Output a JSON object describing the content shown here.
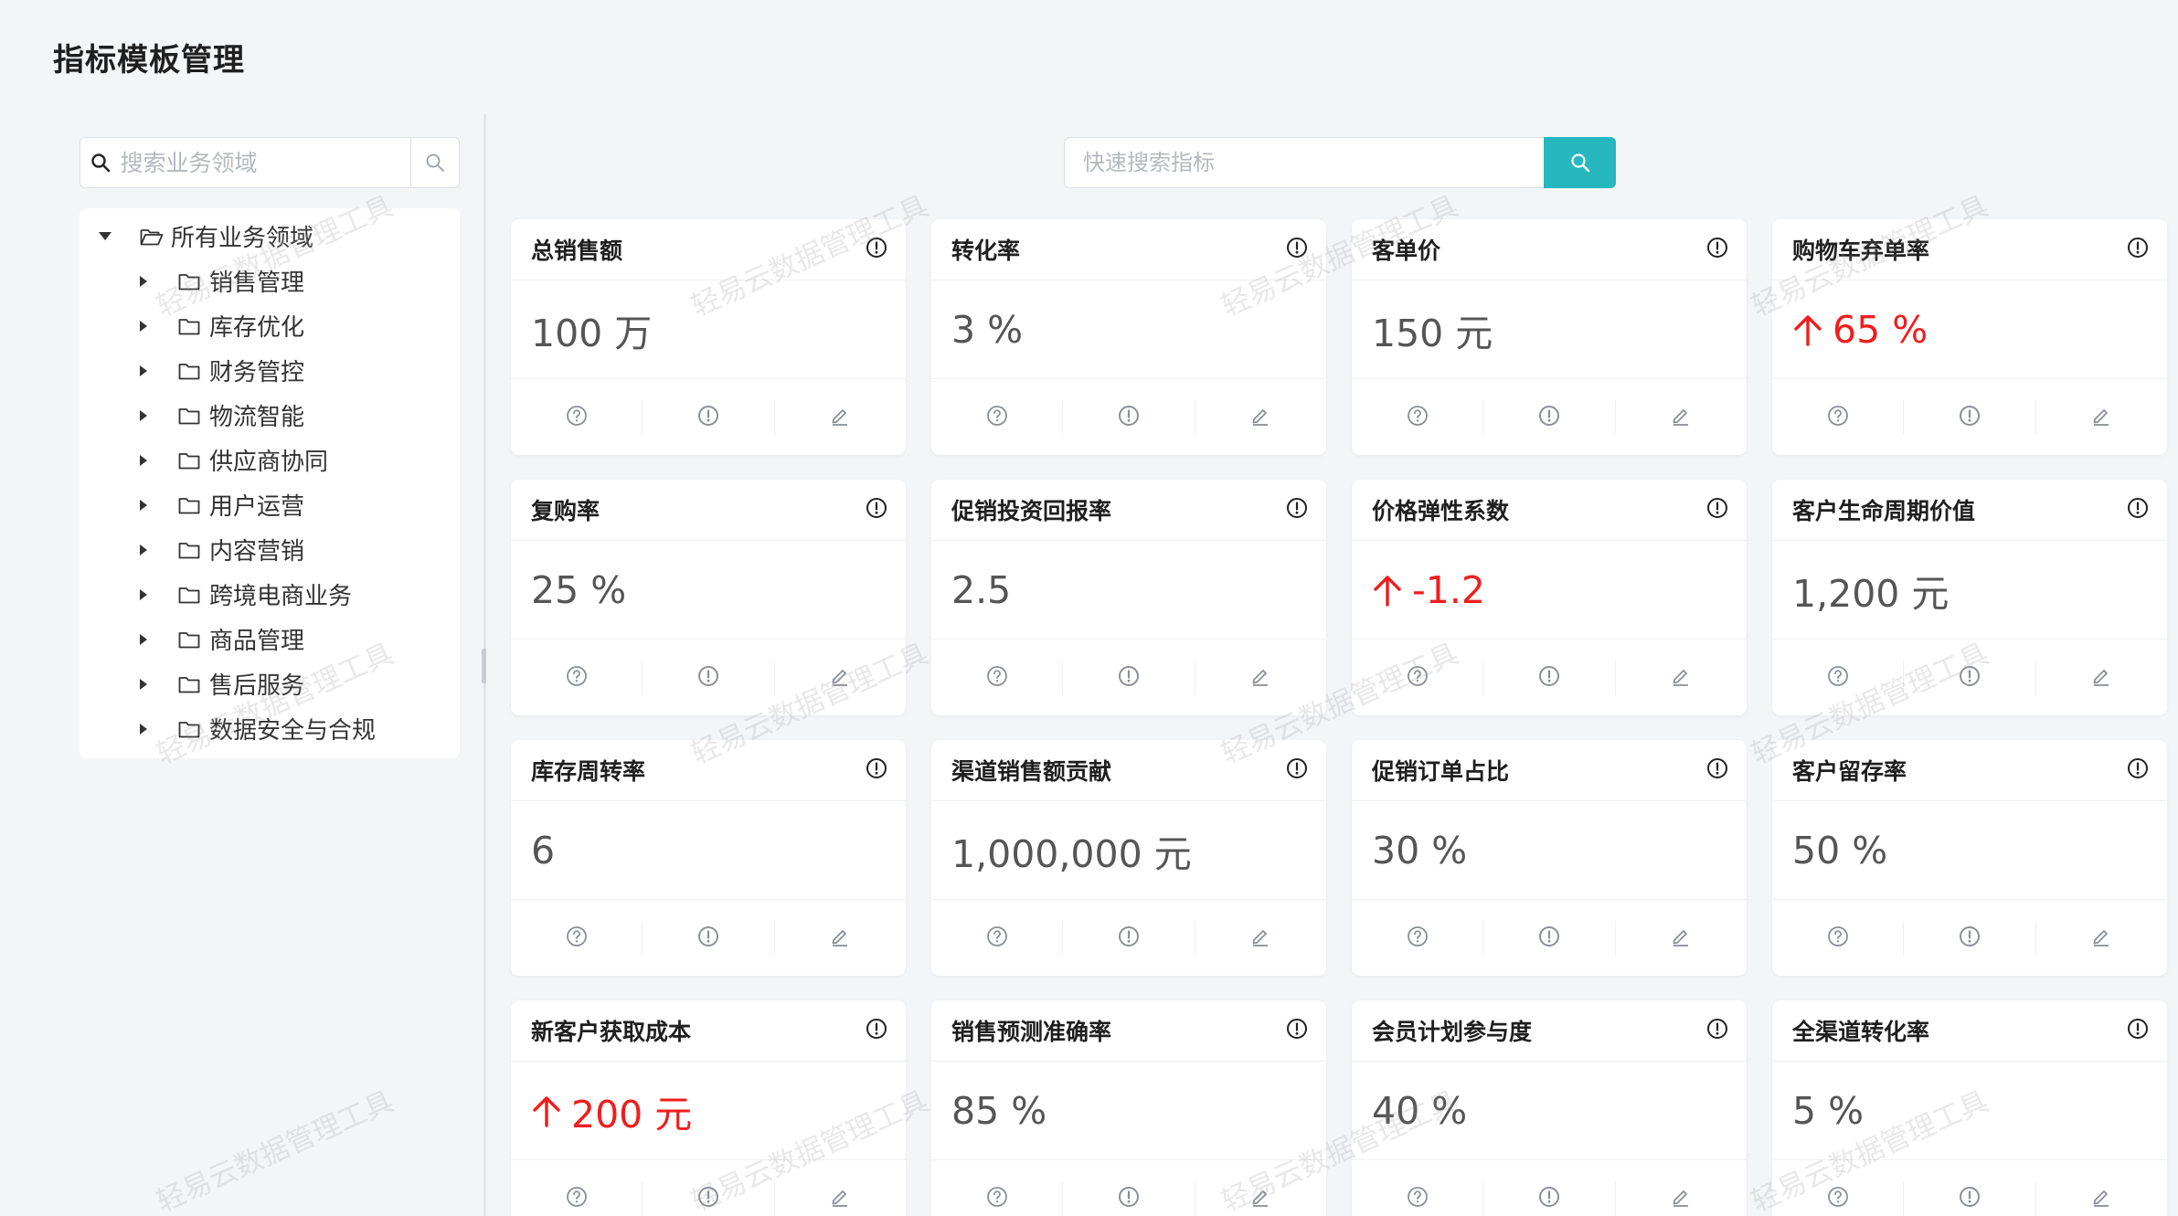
{
  "page": {
    "title": "指标模板管理"
  },
  "sidebar": {
    "search_placeholder": "搜索业务领域",
    "root": {
      "label": "所有业务领域"
    },
    "items": [
      {
        "label": "销售管理"
      },
      {
        "label": "库存优化"
      },
      {
        "label": "财务管控"
      },
      {
        "label": "物流智能"
      },
      {
        "label": "供应商协同"
      },
      {
        "label": "用户运营"
      },
      {
        "label": "内容营销"
      },
      {
        "label": "跨境电商业务"
      },
      {
        "label": "商品管理"
      },
      {
        "label": "售后服务"
      },
      {
        "label": "数据安全与合规"
      }
    ]
  },
  "main": {
    "search_placeholder": "快速搜索指标"
  },
  "cards": [
    {
      "title": "总销售额",
      "value": "100 万",
      "trend": "none"
    },
    {
      "title": "转化率",
      "value": "3 %",
      "trend": "none"
    },
    {
      "title": "客单价",
      "value": "150 元",
      "trend": "none"
    },
    {
      "title": "购物车弃单率",
      "value": "65 %",
      "trend": "up"
    },
    {
      "title": "复购率",
      "value": "25 %",
      "trend": "none"
    },
    {
      "title": "促销投资回报率",
      "value": "2.5",
      "trend": "none"
    },
    {
      "title": "价格弹性系数",
      "value": "-1.2",
      "trend": "up"
    },
    {
      "title": "客户生命周期价值",
      "value": "1,200 元",
      "trend": "none"
    },
    {
      "title": "库存周转率",
      "value": "6",
      "trend": "none"
    },
    {
      "title": "渠道销售额贡献",
      "value": "1,000,000 元",
      "trend": "none"
    },
    {
      "title": "促销订单占比",
      "value": "30 %",
      "trend": "none"
    },
    {
      "title": "客户留存率",
      "value": "50 %",
      "trend": "none"
    },
    {
      "title": "新客户获取成本",
      "value": "200 元",
      "trend": "up"
    },
    {
      "title": "销售预测准确率",
      "value": "85 %",
      "trend": "none"
    },
    {
      "title": "会员计划参与度",
      "value": "40 %",
      "trend": "none"
    },
    {
      "title": "全渠道转化率",
      "value": "5 %",
      "trend": "none"
    }
  ],
  "watermark": {
    "text": "轻易云数据管理工具"
  },
  "colors": {
    "accent": "#26b7bf",
    "trend_up": "#f01d1d",
    "value": "#555555"
  },
  "icons": {
    "card_header": "alert-circle-icon",
    "card_footer": [
      "question-circle-icon",
      "alert-circle-icon",
      "edit-icon"
    ]
  }
}
